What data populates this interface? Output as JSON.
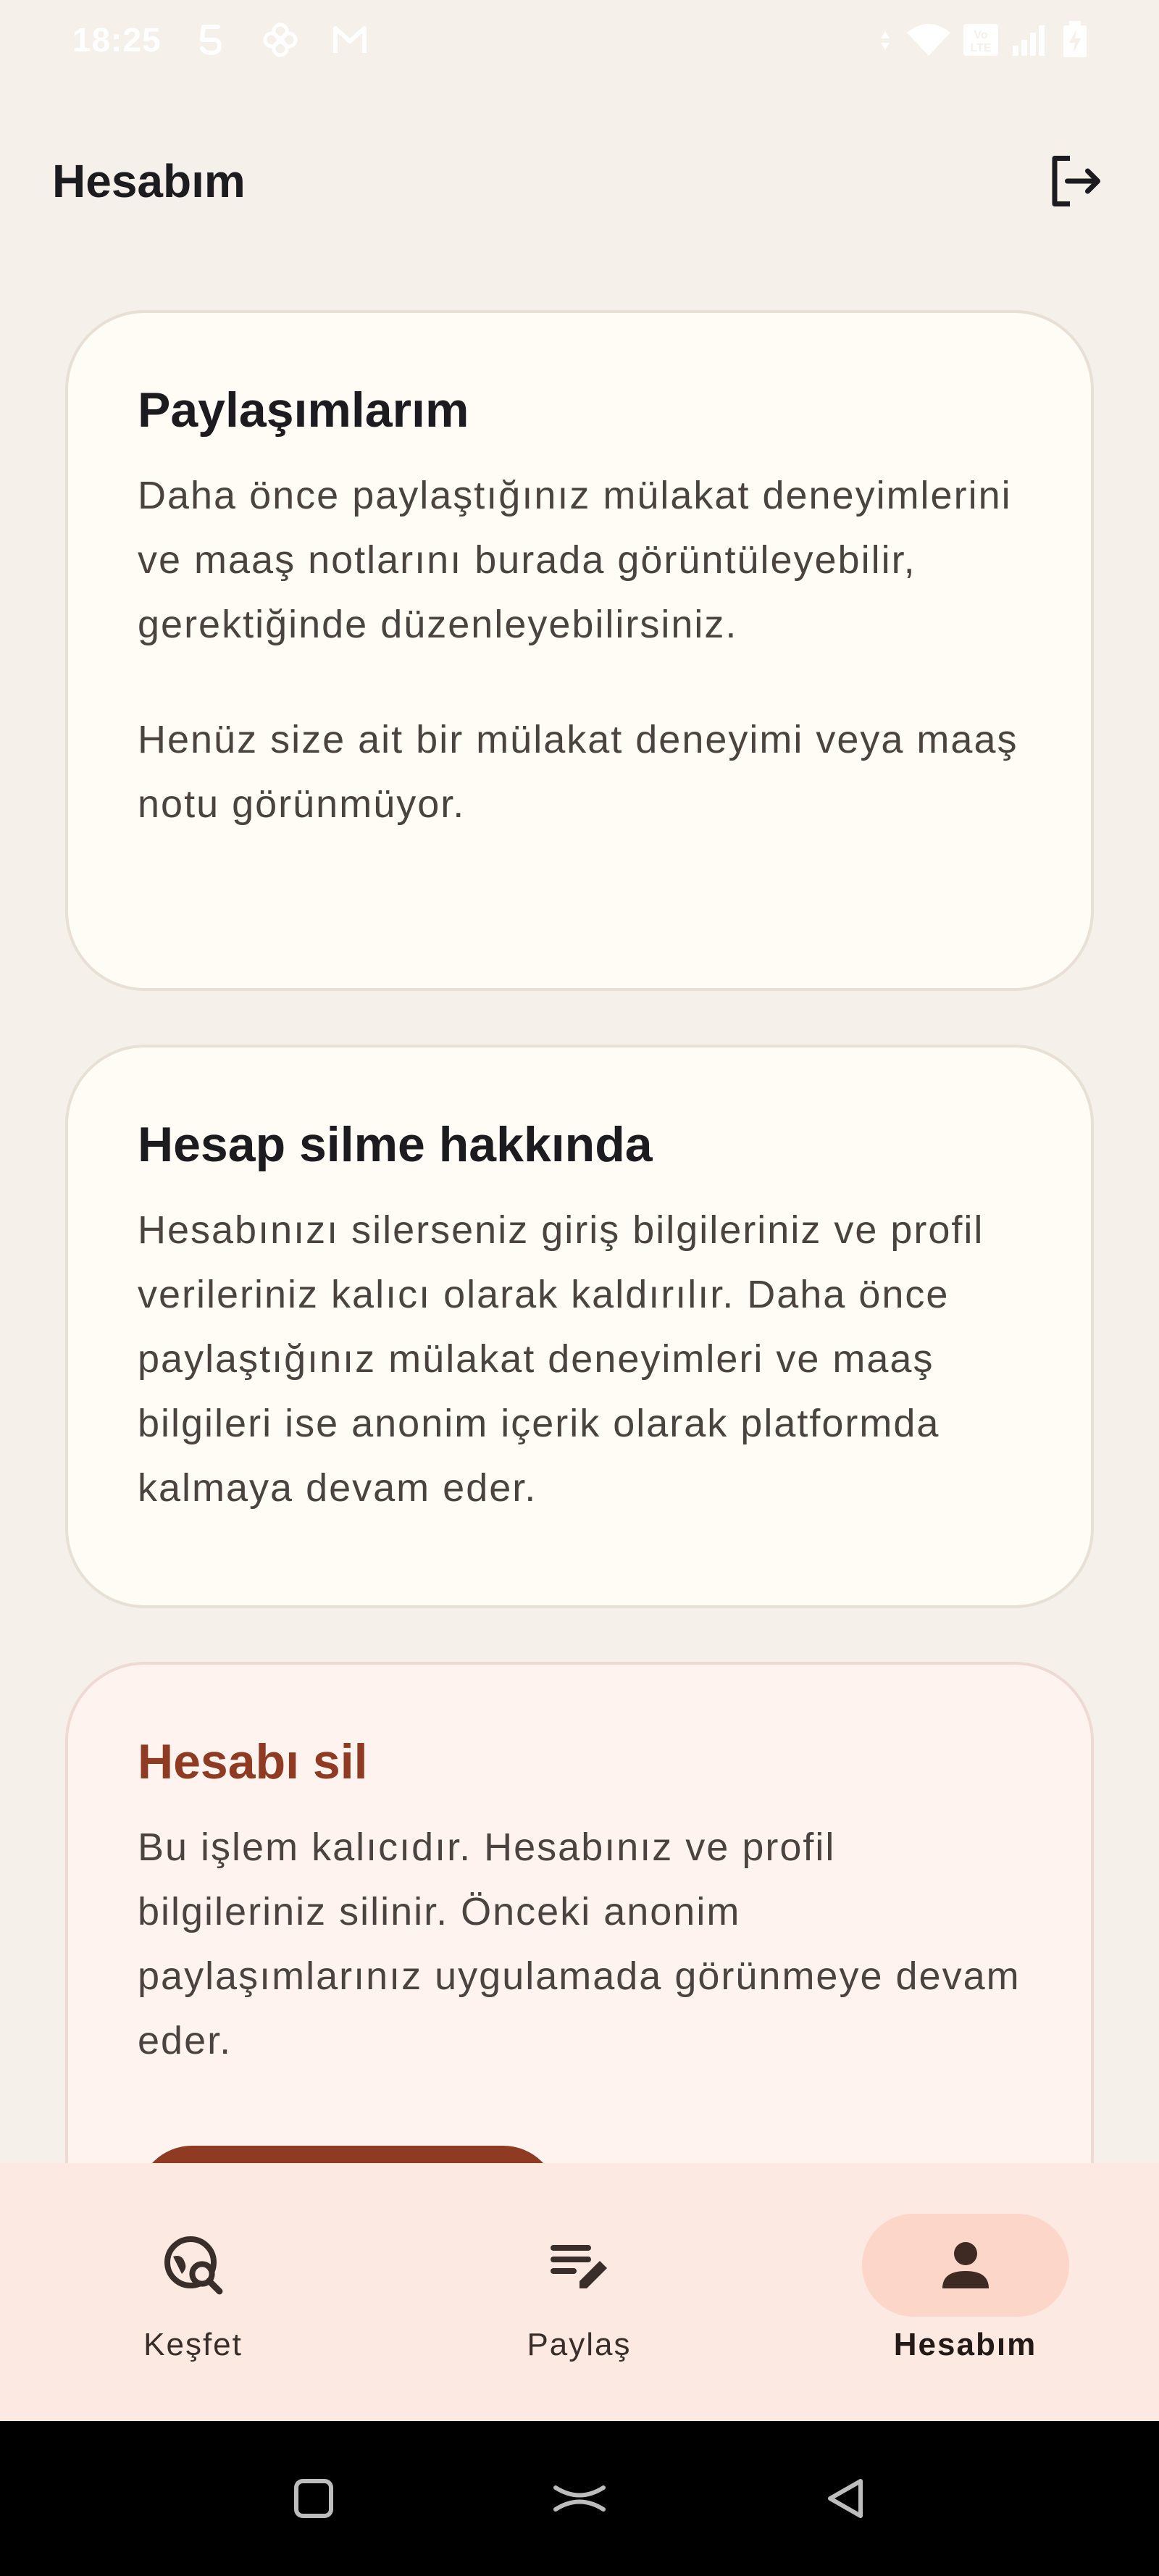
{
  "status_bar": {
    "time": "18:25",
    "left_icons": [
      "s-app-icon",
      "pinwheel-app-icon",
      "gmail-icon"
    ],
    "right_icons": [
      "data-arrows-icon",
      "wifi-icon",
      "volte-icon",
      "signal-icon",
      "battery-icon"
    ]
  },
  "header": {
    "title": "Hesabım",
    "logout_icon": "logout-icon"
  },
  "cards": {
    "shares": {
      "title": "Paylaşımlarım",
      "description": "Daha önce paylaştığınız mülakat deneyimlerini ve maaş notlarını burada görüntüleyebilir, gerektiğinde düzenleyebilirsiniz.",
      "empty_text": "Henüz size ait bir mülakat deneyimi veya maaş notu görünmüyor."
    },
    "deletion_info": {
      "title": "Hesap silme hakkında",
      "description": "Hesabınızı silerseniz giriş bilgileriniz ve profil verileriniz kalıcı olarak kaldırılır. Daha önce paylaştığınız mülakat deneyimleri ve maaş bilgileri ise anonim içerik olarak platformda kalmaya devam eder."
    },
    "delete_account": {
      "title": "Hesabı sil",
      "description": "Bu işlem kalıcıdır. Hesabınız ve profil bilgileriniz silinir. Önceki anonim paylaşımlarınız uygulamada görünmeye devam eder."
    }
  },
  "bottom_nav": {
    "items": [
      {
        "label": "Keşfet",
        "icon": "explore-search-icon",
        "active": false
      },
      {
        "label": "Paylaş",
        "icon": "edit-note-icon",
        "active": false
      },
      {
        "label": "Hesabım",
        "icon": "person-icon",
        "active": true
      }
    ]
  },
  "system_nav": {
    "buttons": [
      "recents-icon",
      "home-icon",
      "back-icon"
    ]
  },
  "colors": {
    "background": "#F5F0EA",
    "card": "#FFFBF5",
    "danger_card": "#FFF3F0",
    "danger_accent": "#8F3A22",
    "nav_bar": "#FCE9E2",
    "active_pill": "#FCD6C8"
  }
}
